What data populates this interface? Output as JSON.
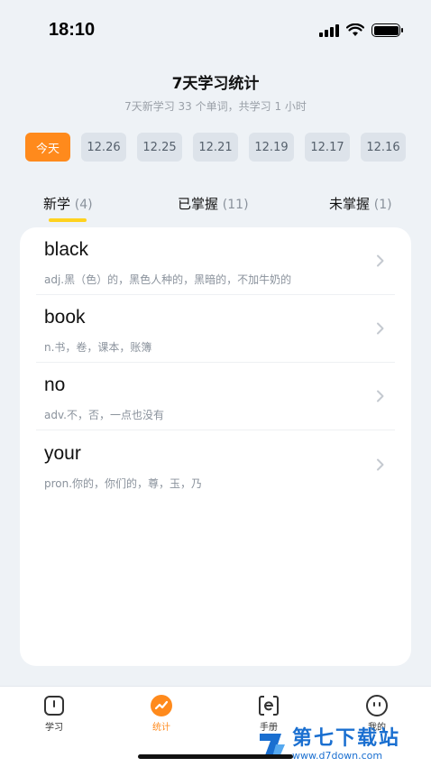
{
  "status_bar": {
    "time": "18:10"
  },
  "header": {
    "title": "7天学习统计",
    "subtitle": "7天新学习 33 个单词，共学习 1 小时"
  },
  "dates": [
    "今天",
    "12.26",
    "12.25",
    "12.21",
    "12.19",
    "12.17",
    "12.16"
  ],
  "tabs": [
    {
      "label": "新学",
      "count": "(4)"
    },
    {
      "label": "已掌握",
      "count": "(11)"
    },
    {
      "label": "未掌握",
      "count": "(1)"
    }
  ],
  "words": [
    {
      "word": "black",
      "definition": "adj.黑（色）的，黑色人种的，黑暗的，不加牛奶的"
    },
    {
      "word": "book",
      "definition": "n.书，卷，课本，账簿"
    },
    {
      "word": "no",
      "definition": "adv.不，否，一点也没有"
    },
    {
      "word": "your",
      "definition": "pron.你的，你们的，尊，玉，乃"
    }
  ],
  "nav": [
    {
      "label": "学习",
      "icon": "study-icon"
    },
    {
      "label": "统计",
      "icon": "stats-icon"
    },
    {
      "label": "手册",
      "icon": "handbook-icon"
    },
    {
      "label": "我的",
      "icon": "profile-icon"
    }
  ],
  "watermark": {
    "title": "第七下载站",
    "url": "www.d7down.com"
  },
  "colors": {
    "accent": "#ff8a1c",
    "underline": "#ffd21f",
    "background": "#eef2f6"
  }
}
